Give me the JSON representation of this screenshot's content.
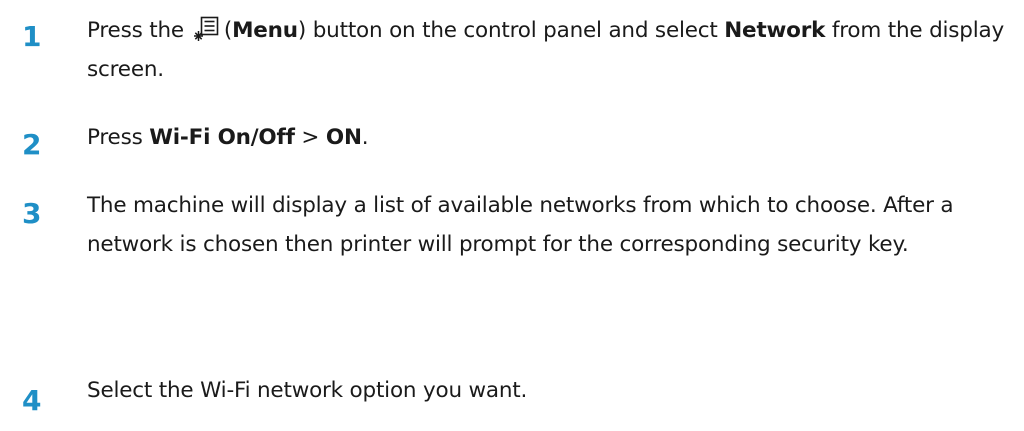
{
  "steps": [
    {
      "number": "1",
      "t1": "Press the",
      "menu_open": "(",
      "menu_label": "Menu",
      "t2": ") button on the control panel and select ",
      "network": "Network",
      "t3": " from the display screen."
    },
    {
      "number": "2",
      "t1": "Press ",
      "wifi": "Wi-Fi On/Off",
      "sep": " > ",
      "on": "ON",
      "t2": "."
    },
    {
      "number": "3",
      "text": "The machine will display a list of available networks from which to choose. After a network is chosen then printer will prompt for the corresponding security key."
    },
    {
      "number": "4",
      "text": "Select the Wi-Fi network option you want."
    }
  ],
  "colors": {
    "step_number": "#1f8fc6",
    "text": "#1a1a1a"
  },
  "icons": {
    "menu": "menu-icon"
  }
}
